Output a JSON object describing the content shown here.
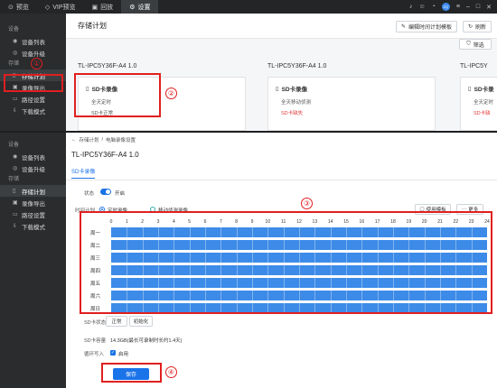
{
  "topbar": {
    "tabs": [
      {
        "icon": "eye-icon",
        "label": "预览"
      },
      {
        "icon": "vip-icon",
        "label": "VIP预览"
      },
      {
        "icon": "playback-icon",
        "label": "回放"
      },
      {
        "icon": "gear-icon",
        "label": "设置"
      }
    ],
    "active_tab": 3,
    "avatar_text": "ZQ"
  },
  "sidebar": {
    "device_section": "设备",
    "device_items": [
      "设备列表",
      "设备升级"
    ],
    "storage_section": "存储",
    "storage_items": [
      "存储计划",
      "录像导出",
      "路径设置",
      "下载模式"
    ],
    "active_item": "存储计划"
  },
  "top_panel": {
    "title": "存储计划",
    "edit_template_button": "编辑时间计划模板",
    "refresh_button": "刷新",
    "filter_button": "筛选",
    "devices": [
      {
        "name": "TL-IPC5Y36F-A4 1.0",
        "card_title": "SD卡录像",
        "line1": "全天定时",
        "line2": "SD卡正常",
        "line2_status": "normal"
      },
      {
        "name": "TL-IPC5Y36F-A4 1.0",
        "card_title": "SD卡录像",
        "line1": "全天移动侦测",
        "line2": "SD卡缺失",
        "line2_status": "error"
      },
      {
        "name": "TL-IPC5Y",
        "card_title": "SD卡录",
        "line1": "全天定时",
        "line2": "SD卡缺",
        "line2_status": "error"
      }
    ]
  },
  "bottom_panel": {
    "breadcrumb_root": "存储计划",
    "breadcrumb_sep": "/",
    "breadcrumb_current": "电脑录像设置",
    "device_title": "TL-IPC5Y36F-A4 1.0",
    "tab_label": "SD卡录像",
    "status_label": "状态",
    "status_value": "开启",
    "plan_label": "时间计划",
    "plan_option_timed": "定时录像",
    "plan_option_motion": "移动侦测录像",
    "use_template_button": "使用模板",
    "more_button": "更多",
    "hours": [
      "0",
      "1",
      "2",
      "3",
      "4",
      "5",
      "6",
      "7",
      "8",
      "9",
      "10",
      "11",
      "12",
      "13",
      "14",
      "15",
      "16",
      "17",
      "18",
      "19",
      "20",
      "21",
      "22",
      "23",
      "24"
    ],
    "days": [
      "周一",
      "周二",
      "周三",
      "周四",
      "周五",
      "周六",
      "周日"
    ],
    "sd_status_label": "SD卡状态",
    "sd_status_value": "正常",
    "init_button": "初始化",
    "sd_capacity_label": "SD卡容量",
    "sd_capacity_value": "14.3GB(最长可录制时长约1.4天)",
    "loop_label": "循环写入",
    "loop_value": "启用",
    "save_button": "保存"
  },
  "annotations": [
    "①",
    "②",
    "③",
    "④"
  ],
  "colors": {
    "accent": "#1a73e8",
    "bar": "#3d8be8",
    "annotation": "#e01f1f",
    "sidebar": "#2a2c2e",
    "topbar": "#232527"
  }
}
